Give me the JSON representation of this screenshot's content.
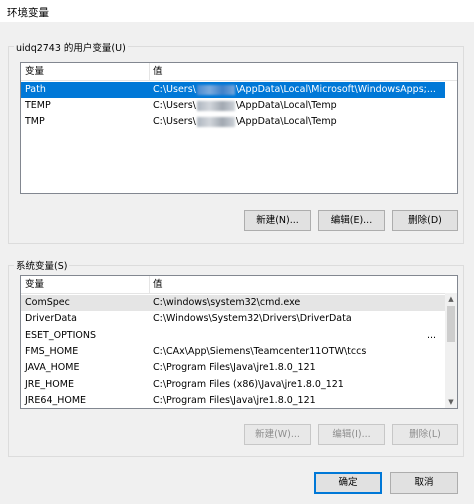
{
  "window": {
    "title": "环境变量"
  },
  "user_vars": {
    "group_label": "uidq2743 的用户变量(U)",
    "columns": [
      "变量",
      "值"
    ],
    "rows": [
      {
        "name": "Path",
        "value_prefix": "C:\\Users\\",
        "value_suffix": "\\AppData\\Local\\Microsoft\\WindowsApps;...",
        "selected": true
      },
      {
        "name": "TEMP",
        "value_prefix": "C:\\Users\\",
        "value_suffix": "\\AppData\\Local\\Temp",
        "selected": false
      },
      {
        "name": "TMP",
        "value_prefix": "C:\\Users\\",
        "value_suffix": "\\AppData\\Local\\Temp",
        "selected": false
      }
    ],
    "buttons": {
      "new": "新建(N)...",
      "edit": "编辑(E)...",
      "delete": "删除(D)"
    }
  },
  "system_vars": {
    "group_label": "系统变量(S)",
    "columns": [
      "变量",
      "值"
    ],
    "rows": [
      {
        "name": "ComSpec",
        "value": "C:\\windows\\system32\\cmd.exe"
      },
      {
        "name": "DriverData",
        "value": "C:\\Windows\\System32\\Drivers\\DriverData"
      },
      {
        "name": "ESET_OPTIONS",
        "value": ""
      },
      {
        "name": "FMS_HOME",
        "value": "C:\\CAx\\App\\Siemens\\Teamcenter11OTW\\tccs"
      },
      {
        "name": "JAVA_HOME",
        "value": "C:\\Program Files\\Java\\jre1.8.0_121"
      },
      {
        "name": "JRE_HOME",
        "value": "C:\\Program Files (x86)\\Java\\jre1.8.0_121"
      },
      {
        "name": "JRE64_HOME",
        "value": "C:\\Program Files\\Java\\jre1.8.0_121"
      }
    ],
    "buttons": {
      "new": "新建(W)...",
      "edit": "编辑(I)...",
      "delete": "删除(L)"
    },
    "buttons_disabled": true,
    "scroll_marker": "..."
  },
  "footer": {
    "ok": "确定",
    "cancel": "取消"
  },
  "colors": {
    "selection": "#0078d7",
    "background": "#f0f0f0"
  }
}
